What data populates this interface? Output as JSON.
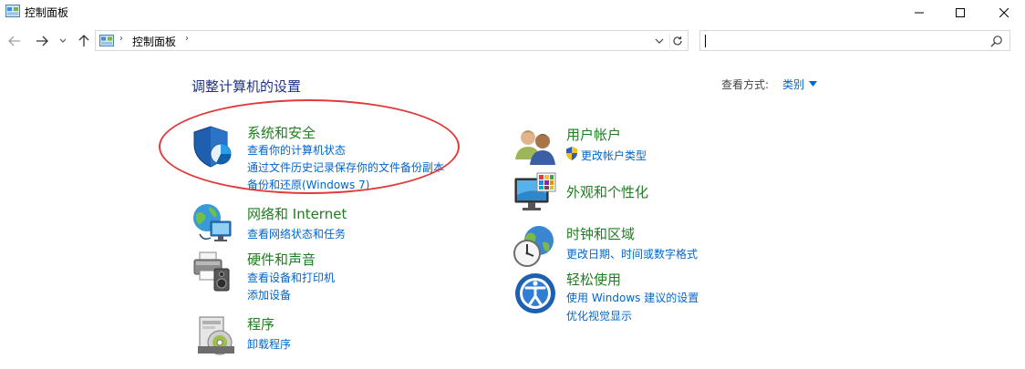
{
  "window": {
    "title": "控制面板",
    "colors": {
      "title_text": "#1e3287",
      "category_text": "#1e7d1e",
      "link_text": "#0066cc",
      "highlight": "#e03a3a"
    }
  },
  "address": {
    "path_label": "控制面板",
    "separator": "›",
    "search_value": ""
  },
  "header": {
    "title": "调整计算机的设置",
    "view_label": "查看方式:",
    "view_value": "类别"
  },
  "categories": {
    "system_security": {
      "title": "系统和安全",
      "icon": "shield-icon",
      "links": [
        "查看你的计算机状态",
        "通过文件历史记录保存你的文件备份副本",
        "备份和还原(Windows 7)"
      ]
    },
    "network": {
      "title": "网络和 Internet",
      "icon": "network-globe-icon",
      "links": [
        "查看网络状态和任务"
      ]
    },
    "hardware": {
      "title": "硬件和声音",
      "icon": "printer-speaker-icon",
      "links": [
        "查看设备和打印机",
        "添加设备"
      ]
    },
    "programs": {
      "title": "程序",
      "icon": "programs-disk-icon",
      "links": [
        "卸载程序"
      ]
    },
    "user_accounts": {
      "title": "用户帐户",
      "icon": "users-icon",
      "links": [
        "更改帐户类型"
      ]
    },
    "appearance": {
      "title": "外观和个性化",
      "icon": "monitor-palette-icon",
      "links": []
    },
    "clock_region": {
      "title": "时钟和区域",
      "icon": "clock-globe-icon",
      "links": [
        "更改日期、时间或数字格式"
      ]
    },
    "ease_of_access": {
      "title": "轻松使用",
      "icon": "ease-of-access-icon",
      "links": [
        "使用 Windows 建议的设置",
        "优化视觉显示"
      ]
    }
  }
}
